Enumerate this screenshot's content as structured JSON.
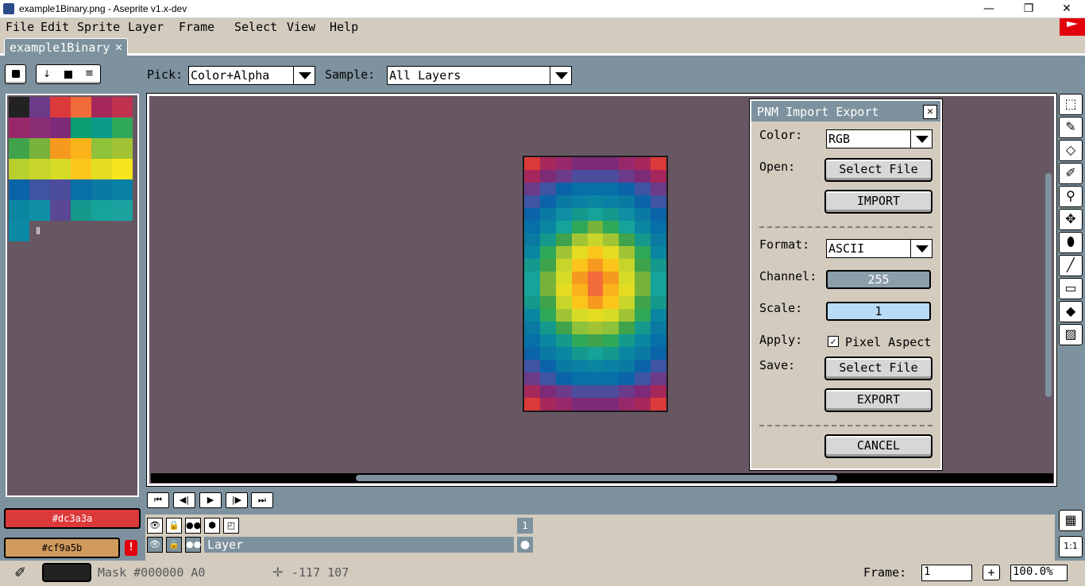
{
  "window": {
    "title": "example1Binary.png - Aseprite v1.x-dev",
    "minimize_glyph": "—",
    "maximize_glyph": "❐",
    "close_glyph": "✕"
  },
  "menu": [
    "File",
    "Edit",
    "Sprite",
    "Layer",
    "Frame",
    "Select",
    "View",
    "Help"
  ],
  "tab": {
    "label": "example1Binary.png",
    "close_glyph": "✕"
  },
  "contextbar": {
    "pick_label": "Pick:",
    "pick_value": "Color+Alpha",
    "sample_label": "Sample:",
    "sample_value": "All Layers"
  },
  "palette": {
    "colors": [
      "#222222",
      "#6b3b8a",
      "#dc3a3a",
      "#f26b3a",
      "#a6285b",
      "#c0304f",
      "#99286a",
      "#8b2d76",
      "#7d2b78",
      "#0c9d70",
      "#0a9b8a",
      "#30a85a",
      "#3ea34b",
      "#77b33a",
      "#f59a1e",
      "#fbb31b",
      "#8fc13a",
      "#a2c434",
      "#b8d02c",
      "#c7d52a",
      "#d6dc25",
      "#fbc51b",
      "#e4dc22",
      "#f7e51e",
      "#0b63a8",
      "#3e55a3",
      "#4d4d9e",
      "#0670a8",
      "#0a7aa2",
      "#0b80a5",
      "#0b86a0",
      "#0f8fa3",
      "#5a4795",
      "#14998d",
      "#15a39a",
      "#1aa39f",
      "#0a8aa3"
    ],
    "extra_glyph": "Ⅱ"
  },
  "sprite": {
    "grid": [
      [
        "#dc3a3a",
        "#a6285b",
        "#99286a",
        "#7d2b78",
        "#7d2b78",
        "#7d2b78",
        "#99286a",
        "#a6285b",
        "#dc3a3a"
      ],
      [
        "#a6285b",
        "#7d2b78",
        "#6b3b8a",
        "#4d4d9e",
        "#4d4d9e",
        "#4d4d9e",
        "#6b3b8a",
        "#7d2b78",
        "#a6285b"
      ],
      [
        "#6b3b8a",
        "#3e55a3",
        "#0b63a8",
        "#0670a8",
        "#0670a8",
        "#0670a8",
        "#0b63a8",
        "#3e55a3",
        "#6b3b8a"
      ],
      [
        "#3e55a3",
        "#0b63a8",
        "#0a7aa2",
        "#0b80a5",
        "#0b86a0",
        "#0b80a5",
        "#0a7aa2",
        "#0b63a8",
        "#3e55a3"
      ],
      [
        "#0b63a8",
        "#0a7aa2",
        "#0f8fa3",
        "#14998d",
        "#15a39a",
        "#14998d",
        "#0f8fa3",
        "#0a7aa2",
        "#0b63a8"
      ],
      [
        "#0670a8",
        "#0b86a0",
        "#15a39a",
        "#30a85a",
        "#77b33a",
        "#30a85a",
        "#15a39a",
        "#0b86a0",
        "#0670a8"
      ],
      [
        "#0a7aa2",
        "#14998d",
        "#3ea34b",
        "#a2c434",
        "#c7d52a",
        "#a2c434",
        "#3ea34b",
        "#14998d",
        "#0a7aa2"
      ],
      [
        "#0b86a0",
        "#30a85a",
        "#a2c434",
        "#e4dc22",
        "#fbc51b",
        "#e4dc22",
        "#a2c434",
        "#30a85a",
        "#0b86a0"
      ],
      [
        "#14998d",
        "#3ea34b",
        "#c7d52a",
        "#fbc51b",
        "#f59a1e",
        "#fbc51b",
        "#c7d52a",
        "#3ea34b",
        "#14998d"
      ],
      [
        "#15a39a",
        "#77b33a",
        "#d6dc25",
        "#f59a1e",
        "#f26b3a",
        "#f59a1e",
        "#d6dc25",
        "#77b33a",
        "#15a39a"
      ],
      [
        "#15a39a",
        "#77b33a",
        "#e4dc22",
        "#fbb31b",
        "#f26b3a",
        "#fbb31b",
        "#e4dc22",
        "#77b33a",
        "#15a39a"
      ],
      [
        "#14998d",
        "#3ea34b",
        "#c7d52a",
        "#fbc51b",
        "#f59a1e",
        "#fbc51b",
        "#c7d52a",
        "#3ea34b",
        "#14998d"
      ],
      [
        "#0b86a0",
        "#30a85a",
        "#a2c434",
        "#d6dc25",
        "#e4dc22",
        "#d6dc25",
        "#a2c434",
        "#30a85a",
        "#0b86a0"
      ],
      [
        "#0a7aa2",
        "#14998d",
        "#3ea34b",
        "#8fc13a",
        "#a2c434",
        "#8fc13a",
        "#3ea34b",
        "#14998d",
        "#0a7aa2"
      ],
      [
        "#0670a8",
        "#0b86a0",
        "#14998d",
        "#30a85a",
        "#3ea34b",
        "#30a85a",
        "#14998d",
        "#0b86a0",
        "#0670a8"
      ],
      [
        "#0b63a8",
        "#0a7aa2",
        "#0b86a0",
        "#14998d",
        "#15a39a",
        "#14998d",
        "#0b86a0",
        "#0a7aa2",
        "#0b63a8"
      ],
      [
        "#3e55a3",
        "#0b63a8",
        "#0a7aa2",
        "#0b80a5",
        "#0b86a0",
        "#0b80a5",
        "#0a7aa2",
        "#0b63a8",
        "#3e55a3"
      ],
      [
        "#6b3b8a",
        "#3e55a3",
        "#0b63a8",
        "#0670a8",
        "#0670a8",
        "#0670a8",
        "#0b63a8",
        "#3e55a3",
        "#6b3b8a"
      ],
      [
        "#a6285b",
        "#7d2b78",
        "#6b3b8a",
        "#4d4d9e",
        "#4d4d9e",
        "#4d4d9e",
        "#6b3b8a",
        "#7d2b78",
        "#a6285b"
      ],
      [
        "#dc3a3a",
        "#a6285b",
        "#99286a",
        "#7d2b78",
        "#7d2b78",
        "#7d2b78",
        "#99286a",
        "#a6285b",
        "#dc3a3a"
      ]
    ]
  },
  "dialog": {
    "title": "PNM Import Export",
    "close_glyph": "✕",
    "color_label": "Color:",
    "color_value": "RGB",
    "open_label": "Open:",
    "select_file_1": "Select File",
    "import_label": "IMPORT",
    "format_label": "Format:",
    "format_value": "ASCII",
    "channel_label": "Channel:",
    "channel_value": "255",
    "scale_label": "Scale:",
    "scale_value": "1",
    "apply_label": "Apply:",
    "pixel_aspect_label": "Pixel Aspect",
    "pixel_aspect_checked": true,
    "check_glyph": "✓",
    "save_label": "Save:",
    "select_file_2": "Select File",
    "export_label": "EXPORT",
    "cancel_label": "CANCEL"
  },
  "tools": [
    "⬚",
    "✎",
    "◇",
    "✐",
    "⚲",
    "✥",
    "⬮",
    "╱",
    "▭",
    "◆",
    "▨"
  ],
  "tools_names": [
    "rectangular-marquee-icon",
    "pencil-icon",
    "eraser-icon",
    "eyedropper-icon",
    "zoom-icon",
    "move-icon",
    "paint-bucket-icon",
    "line-icon",
    "rectangle-icon",
    "contour-icon",
    "blur-icon"
  ],
  "timeline": {
    "frame_number": "1",
    "layer_name": "Layer",
    "cel_glyph": "●",
    "header_icons": [
      "👁",
      "🔒",
      "●●",
      "⬢",
      "◰"
    ],
    "header_icon_names": [
      "visibility-icon",
      "lock-icon",
      "continuous-icon",
      "group-icon",
      "onion-skin-icon"
    ]
  },
  "playback": [
    "⏮",
    "◀|",
    "▶",
    "|▶",
    "⏭"
  ],
  "playback_names": [
    "first-frame-button",
    "previous-frame-button",
    "play-button",
    "next-frame-button",
    "last-frame-button"
  ],
  "colors": {
    "foreground": "#dc3a3a",
    "foreground_label": "#dc3a3a",
    "background": "#cf9a5b",
    "background_label": "#cf9a5b",
    "warning_glyph": "!"
  },
  "statusbar": {
    "mask_text": "Mask #000000 A0",
    "coords": "-117 107",
    "frame_label": "Frame:",
    "frame_value": "1",
    "add_glyph": "+",
    "zoom_value": "100.0%"
  },
  "side_buttons": {
    "film_glyph": "▦",
    "onetoone": "1:1"
  }
}
